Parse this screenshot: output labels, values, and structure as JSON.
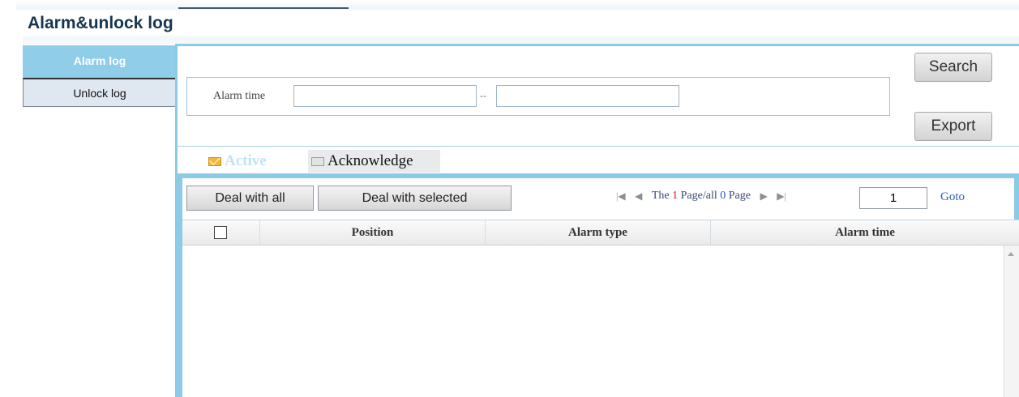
{
  "page": {
    "title": "Alarm&unlock log"
  },
  "sidebar": {
    "items": [
      {
        "label": "Alarm log",
        "active": true
      },
      {
        "label": "Unlock log",
        "active": false
      }
    ]
  },
  "search": {
    "label": "Alarm time",
    "separator": "--",
    "start_value": "",
    "end_value": "",
    "search_button": "Search",
    "export_button": "Export"
  },
  "tabs": [
    {
      "label": "Active",
      "icon": "envelope-open-icon",
      "active": true
    },
    {
      "label": "Acknowledge",
      "icon": "envelope-icon",
      "active": false
    }
  ],
  "toolbar": {
    "deal_all": "Deal with all",
    "deal_selected": "Deal with selected"
  },
  "pager": {
    "prefix": "The",
    "current_page": "1",
    "middle": "Page/all",
    "total_pages": "0",
    "suffix": "Page",
    "goto_value": "1",
    "goto_label": "Goto"
  },
  "table": {
    "columns": [
      "Position",
      "Alarm type",
      "Alarm time"
    ],
    "rows": []
  },
  "colors": {
    "accent": "#8ccbe8",
    "title": "#16364f",
    "link": "#2f5fbf",
    "current_page": "#cc1f1f",
    "total_pages": "#2d4bd6"
  }
}
